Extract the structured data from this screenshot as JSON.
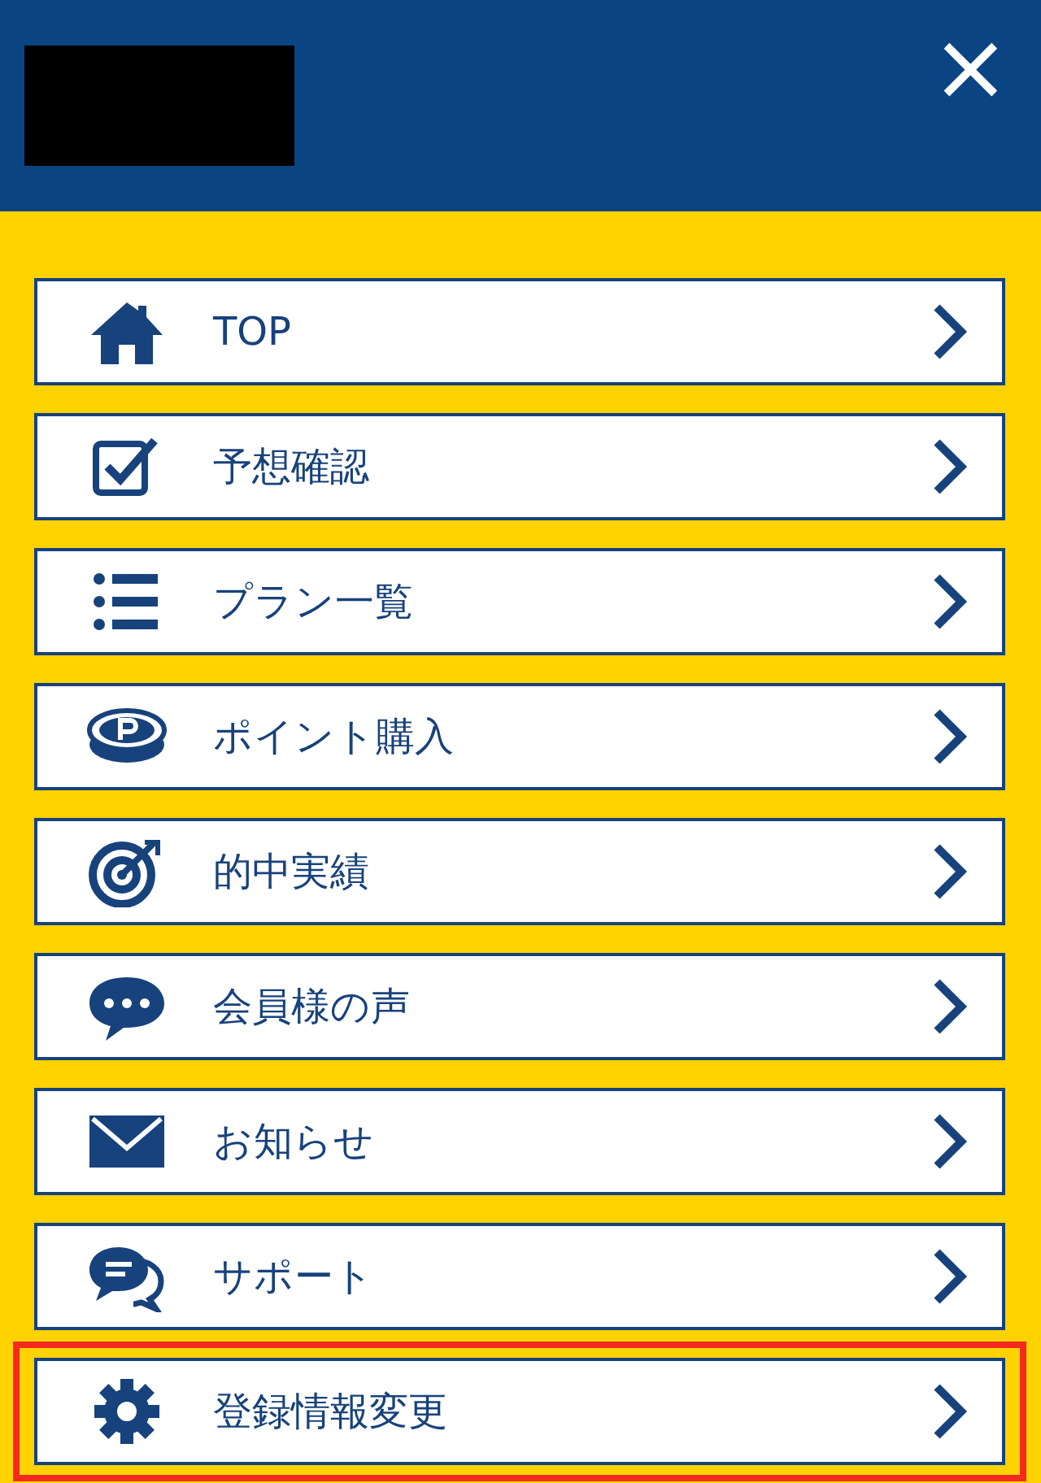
{
  "header": {
    "close_label": "×"
  },
  "menu": [
    {
      "label": "TOP",
      "highlighted": false
    },
    {
      "label": "予想確認",
      "highlighted": false
    },
    {
      "label": "プラン一覧",
      "highlighted": false
    },
    {
      "label": "ポイント購入",
      "highlighted": false
    },
    {
      "label": "的中実績",
      "highlighted": false
    },
    {
      "label": "会員様の声",
      "highlighted": false
    },
    {
      "label": "お知らせ",
      "highlighted": false
    },
    {
      "label": "サポート",
      "highlighted": false
    },
    {
      "label": "登録情報変更",
      "highlighted": true
    }
  ]
}
